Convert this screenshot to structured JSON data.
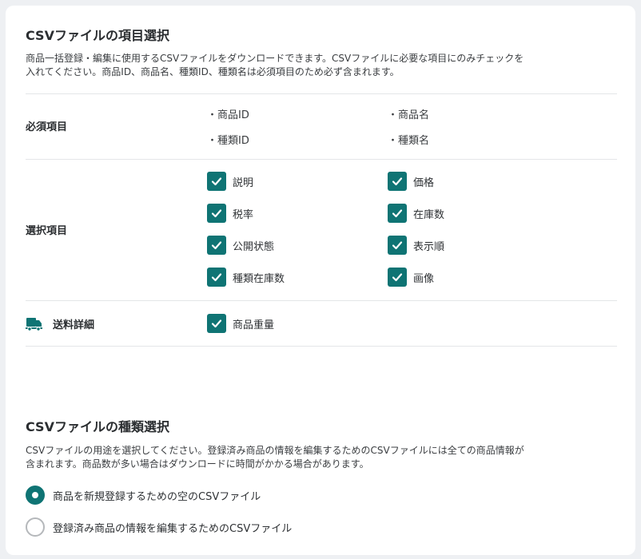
{
  "items_section": {
    "title": "CSVファイルの項目選択",
    "desc_line1": "商品一括登録・編集に使用するCSVファイルをダウンロードできます。CSVファイルに必要な項目にのみチェックを",
    "desc_line2": "入れてください。商品ID、商品名、種類ID、種類名は必須項目のため必ず含まれます。",
    "required": {
      "label": "必須項目",
      "items": [
        "・商品ID",
        "・商品名",
        "・種類ID",
        "・種類名"
      ]
    },
    "optional": {
      "label": "選択項目",
      "items": [
        {
          "label": "説明",
          "checked": true
        },
        {
          "label": "価格",
          "checked": true
        },
        {
          "label": "税率",
          "checked": true
        },
        {
          "label": "在庫数",
          "checked": true
        },
        {
          "label": "公開状態",
          "checked": true
        },
        {
          "label": "表示順",
          "checked": true
        },
        {
          "label": "種類在庫数",
          "checked": true
        },
        {
          "label": "画像",
          "checked": true
        }
      ]
    },
    "shipping": {
      "label": "送料詳細",
      "icon": "truck-icon",
      "items": [
        {
          "label": "商品重量",
          "checked": true
        }
      ]
    }
  },
  "type_section": {
    "title": "CSVファイルの種類選択",
    "desc_line1": "CSVファイルの用途を選択してください。登録済み商品の情報を編集するためのCSVファイルには全ての商品情報が",
    "desc_line2": "含まれます。商品数が多い場合はダウンロードに時間がかかる場合があります。",
    "options": [
      {
        "label": "商品を新規登録するための空のCSVファイル",
        "selected": true
      },
      {
        "label": "登録済み商品の情報を編集するためのCSVファイル",
        "selected": false
      }
    ]
  },
  "colors": {
    "accent": "#0f7474",
    "radio_off": "#b5b8bb"
  }
}
